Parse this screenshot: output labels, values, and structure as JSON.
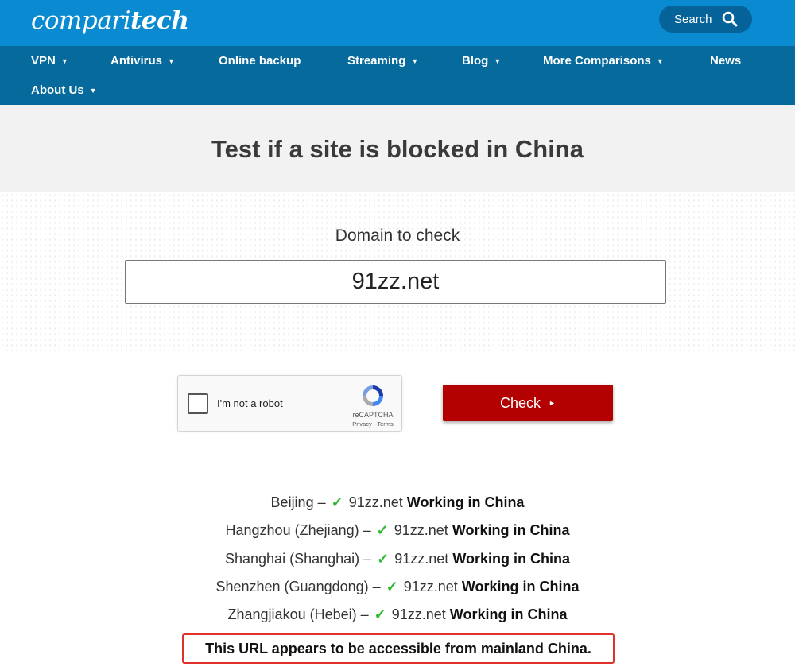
{
  "header": {
    "logo_light": "compari",
    "logo_bold": "tech",
    "search_label": "Search"
  },
  "nav": {
    "items": [
      {
        "label": "VPN",
        "has_dropdown": true
      },
      {
        "label": "Antivirus",
        "has_dropdown": true
      },
      {
        "label": "Online backup",
        "has_dropdown": false
      },
      {
        "label": "Streaming",
        "has_dropdown": true
      },
      {
        "label": "Blog",
        "has_dropdown": true
      },
      {
        "label": "More Comparisons",
        "has_dropdown": true
      },
      {
        "label": "News",
        "has_dropdown": false
      },
      {
        "label": "About Us",
        "has_dropdown": true
      }
    ],
    "caret": "▼"
  },
  "page": {
    "title": "Test if a site is blocked in China"
  },
  "form": {
    "label": "Domain to check",
    "domain_value": "91zz.net",
    "captcha_label": "I'm not a robot",
    "captcha_brand": "reCAPTCHA",
    "captcha_terms": "Privacy - Terms",
    "check_label": "Check",
    "check_arrow": "►"
  },
  "results": {
    "rows": [
      {
        "location": "Beijing",
        "domain": "91zz.net",
        "status": "Working in China"
      },
      {
        "location": "Hangzhou (Zhejiang)",
        "domain": "91zz.net",
        "status": "Working in China"
      },
      {
        "location": "Shanghai (Shanghai)",
        "domain": "91zz.net",
        "status": "Working in China"
      },
      {
        "location": "Shenzhen (Guangdong)",
        "domain": "91zz.net",
        "status": "Working in China"
      },
      {
        "location": "Zhangjiakou (Hebei)",
        "domain": "91zz.net",
        "status": "Working in China"
      }
    ],
    "separator": " – ",
    "check_glyph": "✓",
    "verdict": "This URL appears to be accessible from mainland China."
  },
  "colors": {
    "header_blue": "#0a8bd1",
    "nav_blue": "#076a9d",
    "check_red": "#b30000",
    "success_green": "#2eb82e",
    "verdict_border": "#e0302a"
  }
}
